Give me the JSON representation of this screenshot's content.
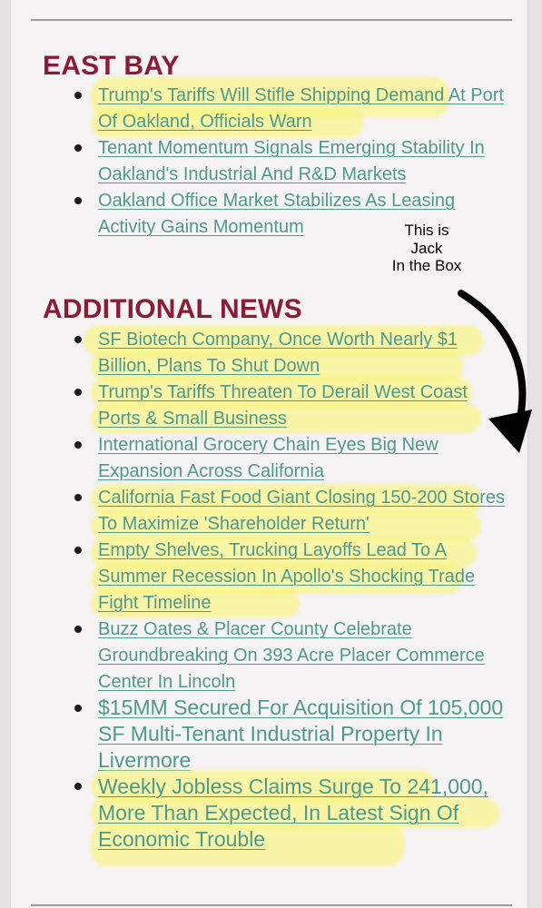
{
  "sections": {
    "east_bay": {
      "title": "EAST BAY",
      "items": [
        {
          "label": "Trump's Tariffs Will Stifle Shipping Demand At Port Of Oakland, Officials Warn",
          "highlighted": true
        },
        {
          "label": "Tenant Momentum Signals Emerging Stability In Oakland's Industrial And R&D Markets",
          "highlighted": false
        },
        {
          "label": "Oakland Office Market Stabilizes As Leasing Activity Gains Momentum",
          "highlighted": false
        }
      ]
    },
    "additional_news": {
      "title": "ADDITIONAL NEWS",
      "items": [
        {
          "label": "SF Biotech Company, Once Worth Nearly $1 Billion, Plans To Shut Down",
          "highlighted": true
        },
        {
          "label": "Trump's Tariffs Threaten To Derail West Coast Ports & Small Business",
          "highlighted": true
        },
        {
          "label": "International Grocery Chain Eyes Big New Expansion Across California",
          "highlighted": false
        },
        {
          "label": "California Fast Food Giant Closing 150-200 Stores To Maximize 'Shareholder Return'",
          "highlighted": true
        },
        {
          "label": "Empty Shelves, Trucking Layoffs Lead To A Summer Recession In Apollo's Shocking Trade Fight Timeline",
          "highlighted": true
        },
        {
          "label": "Buzz Oates & Placer County Celebrate Groundbreaking On 393 Acre Placer Commerce Center In Lincoln",
          "highlighted": false
        },
        {
          "label": "$15MM Secured For Acquisition Of 105,000 SF Multi-Tenant Industrial Property In Livermore",
          "highlighted": false
        },
        {
          "label": "Weekly Jobless Claims Surge To 241,000, More Than Expected, In Latest Sign Of Economic Trouble",
          "highlighted": true
        }
      ]
    }
  },
  "annotation": {
    "lines": [
      "This is",
      "Jack",
      "In the Box"
    ],
    "arrow_icon": "curved-arrow-icon"
  },
  "colors": {
    "heading": "#8a1c36",
    "link": "#4f9a8b",
    "highlight": "#faf578"
  }
}
